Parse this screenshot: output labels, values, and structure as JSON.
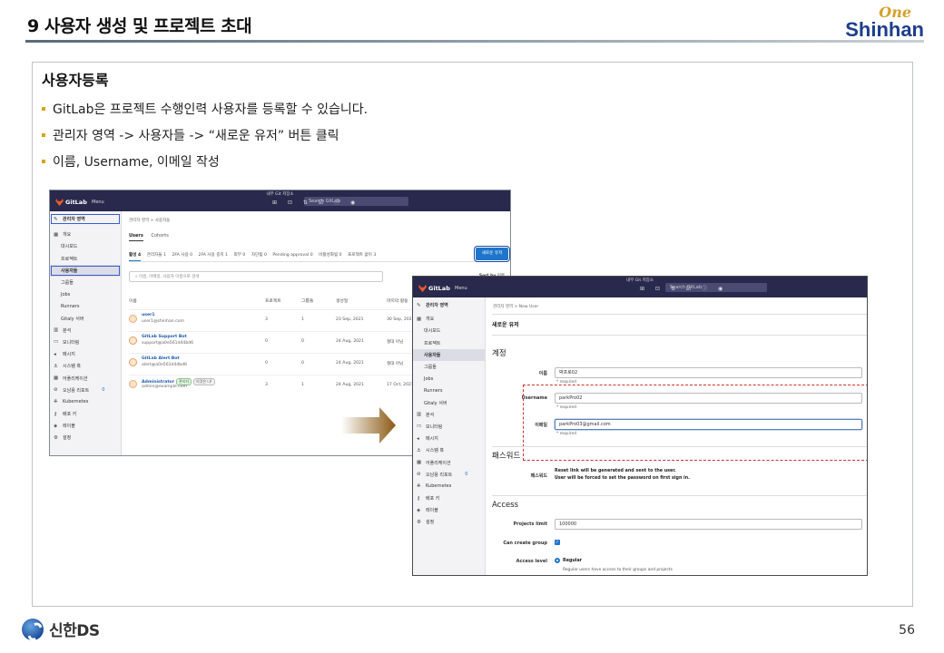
{
  "slide": {
    "title": "9 사용자 생성 및 프로젝트 초대",
    "brand_one": "One",
    "brand_name": "Shinhan",
    "section_heading": "사용자등록",
    "bullets": [
      "GitLab은 프로젝트 수행인력 사용자를 등록할 수 있습니다.",
      "관리자 영역 -> 사용자들 -> “새로운 유저” 버튼 클릭",
      "이름, Username, 이메일 작성"
    ],
    "footer_logo_text": "신한DS",
    "page_number": "56",
    "colors": {
      "bullet": "#d7a322",
      "gitlab_topbar": "#29294d",
      "gitlab_primary": "#1f75cb",
      "highlight": "#d23030"
    }
  },
  "gitlab_top": {
    "notice": "내부 Git 저장소",
    "app_name": "GitLab",
    "menu_label": "Menu",
    "search_placeholder": "Search GitLab",
    "icons": [
      "plus-icon",
      "chevron-down-icon",
      "merge-request-icon",
      "issues-icon",
      "todo-icon",
      "help-icon",
      "avatar-icon"
    ]
  },
  "sidebar": {
    "header": "관리자 영역",
    "items": [
      {
        "label": "개요",
        "icon": "overview-icon",
        "sub": false
      },
      {
        "label": "대시보드",
        "sub": true
      },
      {
        "label": "프로젝트",
        "sub": true
      },
      {
        "label": "사용자들",
        "sub": true
      },
      {
        "label": "그룹들",
        "sub": true
      },
      {
        "label": "Jobs",
        "sub": true
      },
      {
        "label": "Runners",
        "sub": true
      },
      {
        "label": "Gitaly 서버",
        "sub": true
      },
      {
        "label": "분석",
        "icon": "analytics-icon",
        "sub": false
      },
      {
        "label": "모니터링",
        "icon": "monitor-icon",
        "sub": false
      },
      {
        "label": "메시지",
        "icon": "message-icon",
        "sub": false
      },
      {
        "label": "시스템 훅",
        "icon": "hook-icon",
        "sub": false
      },
      {
        "label": "어플리케이션",
        "icon": "apps-icon",
        "sub": false
      },
      {
        "label": "오남용 리포트",
        "icon": "abuse-icon",
        "sub": false,
        "count": "0"
      },
      {
        "label": "Kubernetes",
        "icon": "kubernetes-icon",
        "sub": false
      },
      {
        "label": "배포 키",
        "icon": "key-icon",
        "sub": false
      },
      {
        "label": "레이블",
        "icon": "label-icon",
        "sub": false
      },
      {
        "label": "설정",
        "icon": "gear-icon",
        "sub": false
      }
    ]
  },
  "users_page": {
    "breadcrumb": "관리자 영역 > 사용자들",
    "tabs": [
      "Users",
      "Cohorts"
    ],
    "filters": [
      "활성 4",
      "관리자들 1",
      "2FA 사용 0",
      "2FA 사용 중지 1",
      "외부 0",
      "차단됨 0",
      "Pending approval 0",
      "비활성화됨 0",
      "프로젝트 없이 3"
    ],
    "new_user_button": "새로운 유저",
    "search_placeholder": "이름, 이메일, 사용자 이름으로 검색",
    "sort_label": "Sort by",
    "sort_value": "이름",
    "columns": [
      "이름",
      "프로젝트",
      "그룹들",
      "생성일",
      "마지막 활동"
    ],
    "rows": [
      {
        "name": "user1",
        "email": "user1@shinhan.com",
        "projects": "3",
        "groups": "1",
        "created": "23 Sep, 2021",
        "last": "30 Sep, 2021",
        "badges": []
      },
      {
        "name": "GitLab Support Bot",
        "email": "support@a0e561d44bd6",
        "projects": "0",
        "groups": "0",
        "created": "24 Aug, 2021",
        "last": "절대 아님",
        "badges": []
      },
      {
        "name": "GitLab Alert Bot",
        "email": "alert@a0e561d44bd6",
        "projects": "0",
        "groups": "0",
        "created": "24 Aug, 2021",
        "last": "절대 아님",
        "badges": []
      },
      {
        "name": "Administrator",
        "email": "admin@example.com",
        "projects": "3",
        "groups": "1",
        "created": "24 Aug, 2021",
        "last": "17 Oct, 2021",
        "badges": [
          "관리자",
          "이것은 나!"
        ]
      }
    ]
  },
  "new_user_page": {
    "breadcrumb": "관리자 영역 > New User",
    "title": "새로운 유저",
    "section_account": "계정",
    "name_label": "이름",
    "name_value": "박프로02",
    "username_label": "Username",
    "username_value": "parkPro02",
    "email_label": "이메일",
    "email_value": "parkPro03@gmail.com",
    "required_text": "* required",
    "section_password": "패스워드",
    "password_label": "패스워드",
    "password_line1": "Reset link will be generated and sent to the user.",
    "password_line2": "User will be forced to set the password on first sign in.",
    "section_access": "Access",
    "projects_limit_label": "Projects limit",
    "projects_limit_value": "100000",
    "can_create_group_label": "Can create group",
    "access_level_label": "Access level",
    "access_level_value": "Regular",
    "access_level_desc": "Regular users have access to their groups and projects"
  }
}
